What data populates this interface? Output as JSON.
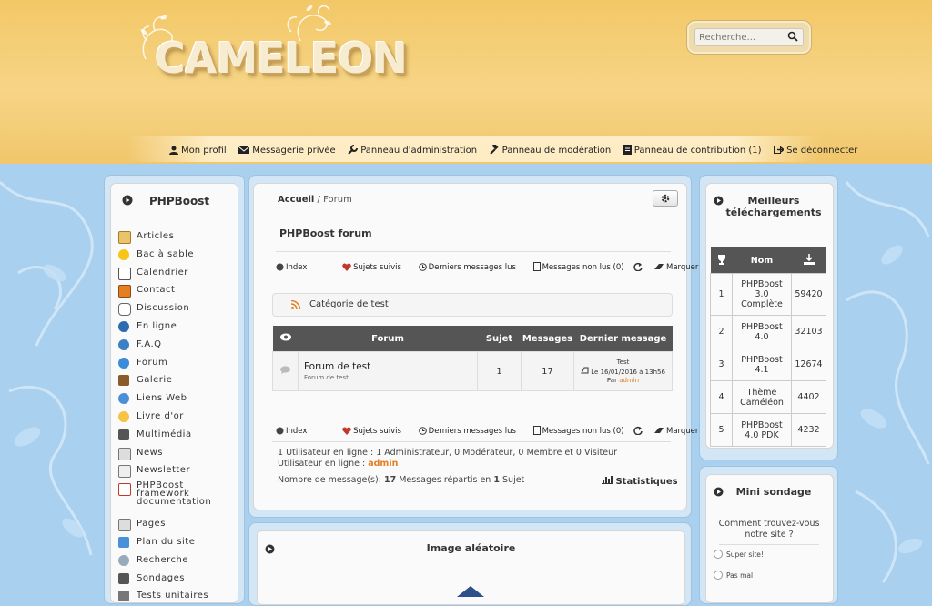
{
  "header": {
    "logo_text": "CAMELEON",
    "search": {
      "placeholder": "Recherche..."
    }
  },
  "usermenu": {
    "items": [
      {
        "label": "Mon profil",
        "icon": "user-icon"
      },
      {
        "label": "Messagerie privée",
        "icon": "envelope-icon"
      },
      {
        "label": "Panneau d'administration",
        "icon": "wrench-icon"
      },
      {
        "label": "Panneau de modération",
        "icon": "gavel-icon"
      },
      {
        "label": "Panneau de contribution (1)",
        "icon": "document-icon"
      },
      {
        "label": "Se déconnecter",
        "icon": "logout-icon"
      }
    ]
  },
  "left_menu": {
    "title": "PHPBoost",
    "items": [
      "Articles",
      "Bac à sable",
      "Calendrier",
      "Contact",
      "Discussion",
      "En ligne",
      "F.A.Q",
      "Forum",
      "Galerie",
      "Liens Web",
      "Livre d'or",
      "Multimédia",
      "News",
      "Newsletter",
      "PHPBoost framework documentation",
      "Pages",
      "Plan du site",
      "Recherche",
      "Sondages",
      "Tests unitaires"
    ]
  },
  "main": {
    "breadcrumb": {
      "home": "Accueil",
      "separator": "/",
      "current": "Forum"
    },
    "forum_title": "PHPBoost forum",
    "links": {
      "index": "Index",
      "followed": "Sujets suivis",
      "last_read": "Derniers messages lus",
      "unread": "Messages non lus (0)",
      "mark_read": "Marquer comme lu"
    },
    "category": "Catégorie de test",
    "table": {
      "headers": {
        "forum": "Forum",
        "topics": "Sujet",
        "messages": "Messages",
        "last": "Dernier message"
      },
      "rows": [
        {
          "name": "Forum de test",
          "desc": "Forum de test",
          "topics": "1",
          "messages": "17",
          "last_title": "Test",
          "last_date": "Le 16/01/2016 à 13h56",
          "last_by_prefix": "Par",
          "last_by": "admin"
        }
      ]
    },
    "online": {
      "line1": "1 Utilisateur en ligne : 1 Administrateur, 0 Modérateur, 0 Membre et 0 Visiteur",
      "line2_prefix": "Utilisateur en ligne :",
      "line2_user": "admin",
      "line3_prefix": "Nombre de message(s):",
      "line3_count": "17",
      "line3_mid": "Messages répartis en",
      "line3_topics": "1",
      "line3_suffix": "Sujet"
    },
    "stats_label": "Statistiques",
    "random_image_title": "Image aléatoire"
  },
  "right": {
    "downloads_title": "Meilleurs téléchargements",
    "downloads_header_name": "Nom",
    "downloads": [
      {
        "rank": "1",
        "name": "PHPBoost 3.0 Complète",
        "count": "59420"
      },
      {
        "rank": "2",
        "name": "PHPBoost 4.0",
        "count": "32103"
      },
      {
        "rank": "3",
        "name": "PHPBoost 4.1",
        "count": "12674"
      },
      {
        "rank": "4",
        "name": "Thème Caméléon",
        "count": "4402"
      },
      {
        "rank": "5",
        "name": "PHPBoost 4.0 PDK",
        "count": "4232"
      }
    ],
    "poll_title": "Mini sondage",
    "poll_question": "Comment trouvez-vous notre site ?",
    "poll_options": [
      "Super site!",
      "Pas mal"
    ]
  }
}
